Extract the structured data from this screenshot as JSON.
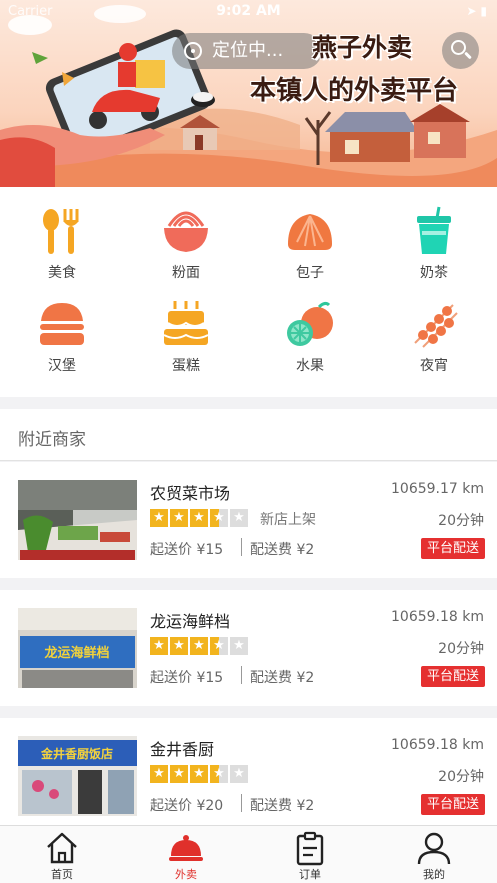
{
  "status_bar": {
    "carrier": "Carrier",
    "time": "9:02 AM",
    "battery": "▮"
  },
  "header": {
    "location_label": "定位中...",
    "slogan_line1": "燕子外卖",
    "slogan_line2": "本镇人的外卖平台"
  },
  "categories": [
    {
      "label": "美食",
      "icon": "fork-spoon-icon"
    },
    {
      "label": "粉面",
      "icon": "noodle-bowl-icon"
    },
    {
      "label": "包子",
      "icon": "bun-icon"
    },
    {
      "label": "奶茶",
      "icon": "milk-tea-icon"
    },
    {
      "label": "汉堡",
      "icon": "burger-icon"
    },
    {
      "label": "蛋糕",
      "icon": "cake-icon"
    },
    {
      "label": "水果",
      "icon": "fruit-icon"
    },
    {
      "label": "夜宵",
      "icon": "skewer-icon"
    }
  ],
  "nearby": {
    "title": "附近商家",
    "shops": [
      {
        "name": "农贸菜市场",
        "distance": "10659.17 km",
        "rating": 3.5,
        "tag": "新店上架",
        "eta": "20分钟",
        "min_order": "起送价 ¥15",
        "delivery_fee": "配送费 ¥2",
        "badge": "平台配送"
      },
      {
        "name": "龙运海鲜档",
        "distance": "10659.18 km",
        "rating": 3.5,
        "tag": "",
        "eta": "20分钟",
        "min_order": "起送价 ¥15",
        "delivery_fee": "配送费 ¥2",
        "badge": "平台配送",
        "sign_text": "龙运海鲜档"
      },
      {
        "name": "金井香厨",
        "distance": "10659.18 km",
        "rating": 3.5,
        "tag": "",
        "eta": "20分钟",
        "min_order": "起送价 ¥20",
        "delivery_fee": "配送费 ¥2",
        "badge": "平台配送",
        "sign_text": "金井香厨饭店"
      }
    ]
  },
  "tabbar": [
    {
      "label": "首页",
      "icon": "home-icon",
      "active": false
    },
    {
      "label": "外卖",
      "icon": "cloche-icon",
      "active": true
    },
    {
      "label": "订单",
      "icon": "clipboard-icon",
      "active": false
    },
    {
      "label": "我的",
      "icon": "user-icon",
      "active": false
    }
  ],
  "colors": {
    "accent": "#e0302b",
    "star": "#f2b41e",
    "badge": "#e53030"
  }
}
